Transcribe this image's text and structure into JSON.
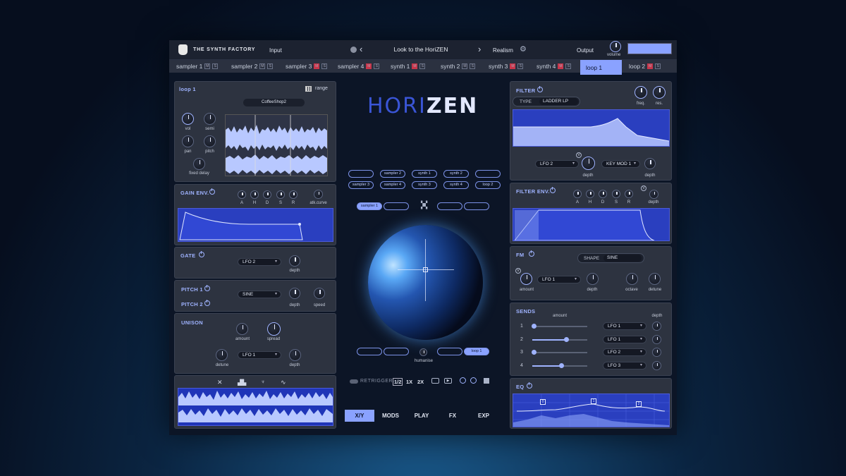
{
  "brand": {
    "logo_text": "THE SYNTH FACTORY"
  },
  "header": {
    "input_label": "Input",
    "preset_name": "Look to the HoriZEN",
    "realism_label": "Realism",
    "output_label": "Output",
    "volume_label": "volume"
  },
  "tabs": [
    {
      "label": "sampler 1",
      "m": "M",
      "s": "S",
      "red": false
    },
    {
      "label": "sampler 2",
      "m": "M",
      "s": "S",
      "red": false
    },
    {
      "label": "sampler 3",
      "m": "M",
      "s": "S",
      "red": true
    },
    {
      "label": "sampler 4",
      "m": "M",
      "s": "S",
      "red": true
    },
    {
      "label": "synth 1",
      "m": "M",
      "s": "S",
      "red": true
    },
    {
      "label": "synth 2",
      "m": "M",
      "s": "S",
      "red": false
    },
    {
      "label": "synth 3",
      "m": "M",
      "s": "S",
      "red": true
    },
    {
      "label": "synth 4",
      "m": "M",
      "s": "S",
      "red": true
    },
    {
      "label": "loop 1",
      "m": "M",
      "s": "S",
      "red": false,
      "active": true
    },
    {
      "label": "loop 2",
      "m": "M",
      "s": "S",
      "red": true
    }
  ],
  "loop": {
    "title": "loop 1",
    "range": "range",
    "sample": "CoffeeShop2",
    "vol": "vol",
    "semi": "semi",
    "pan": "pan",
    "pitch": "pitch",
    "fixed_delay": "fixed delay"
  },
  "gain": {
    "title": "GAIN ENV.",
    "a": "A",
    "h": "H",
    "d": "D",
    "s": "S",
    "r": "R",
    "curve": "atk.curve"
  },
  "gate": {
    "title": "GATE",
    "source": "LFO 2",
    "depth": "depth"
  },
  "pitchp": {
    "title1": "PITCH 1",
    "title2": "PITCH 2",
    "shape": "SINE",
    "depth": "depth",
    "speed": "speed"
  },
  "unison": {
    "title": "UNISON",
    "amount": "amount",
    "spread": "spread",
    "source": "LFO 1",
    "detune": "detune",
    "depth": "depth"
  },
  "logo": {
    "part1": "HORI",
    "part2": "ZEN"
  },
  "center": {
    "slots_row1": [
      "",
      "sampler 2",
      "synth 1",
      "synth 2",
      ""
    ],
    "slots_row2": [
      "sampler 3",
      "sampler 4",
      "synth 3",
      "synth 4",
      "loop 2"
    ],
    "top_row": [
      "sampler 1",
      "",
      "",
      "",
      ""
    ],
    "bottom_row": [
      "",
      "",
      "",
      "",
      "loop 1"
    ],
    "humanise": "humanise",
    "retrigger": "RETRIGGER.",
    "rates": [
      "1/2",
      "1X",
      "2X"
    ]
  },
  "nav": [
    "X/Y",
    "MODS",
    "PLAY",
    "FX",
    "EXP"
  ],
  "filter": {
    "title": "FILTER",
    "type_label": "TYPE",
    "type": "LADDER LP",
    "freq": "freq.",
    "res": "res.",
    "mod1": "LFO 2",
    "depth1": "depth",
    "mod2": "KEY MOD 1",
    "depth2": "depth"
  },
  "fenv": {
    "title": "FILTER ENV.",
    "a": "A",
    "h": "H",
    "d": "D",
    "s": "S",
    "r": "R",
    "depth": "depth"
  },
  "fm": {
    "title": "FM",
    "shape_label": "SHAPE",
    "shape": "SINE",
    "amount": "amount",
    "source": "LFO 1",
    "depth": "depth",
    "octave": "octave",
    "detune": "detune"
  },
  "sends": {
    "title": "SENDS",
    "amount": "amount",
    "depth": "depth",
    "rows": [
      {
        "n": "1",
        "src": "LFO 1",
        "level": 0.02
      },
      {
        "n": "2",
        "src": "LFO 1",
        "level": 0.62
      },
      {
        "n": "3",
        "src": "LFO 2",
        "level": 0.02
      },
      {
        "n": "4",
        "src": "LFO 3",
        "level": 0.52
      }
    ]
  },
  "eq": {
    "title": "EQ",
    "b1": "0",
    "b2": "1",
    "b3": "2"
  },
  "colors": {
    "accent": "#8aa2ff",
    "red": "#c8354a",
    "panel": "#2d3340",
    "screen": "#2a3fbf"
  }
}
